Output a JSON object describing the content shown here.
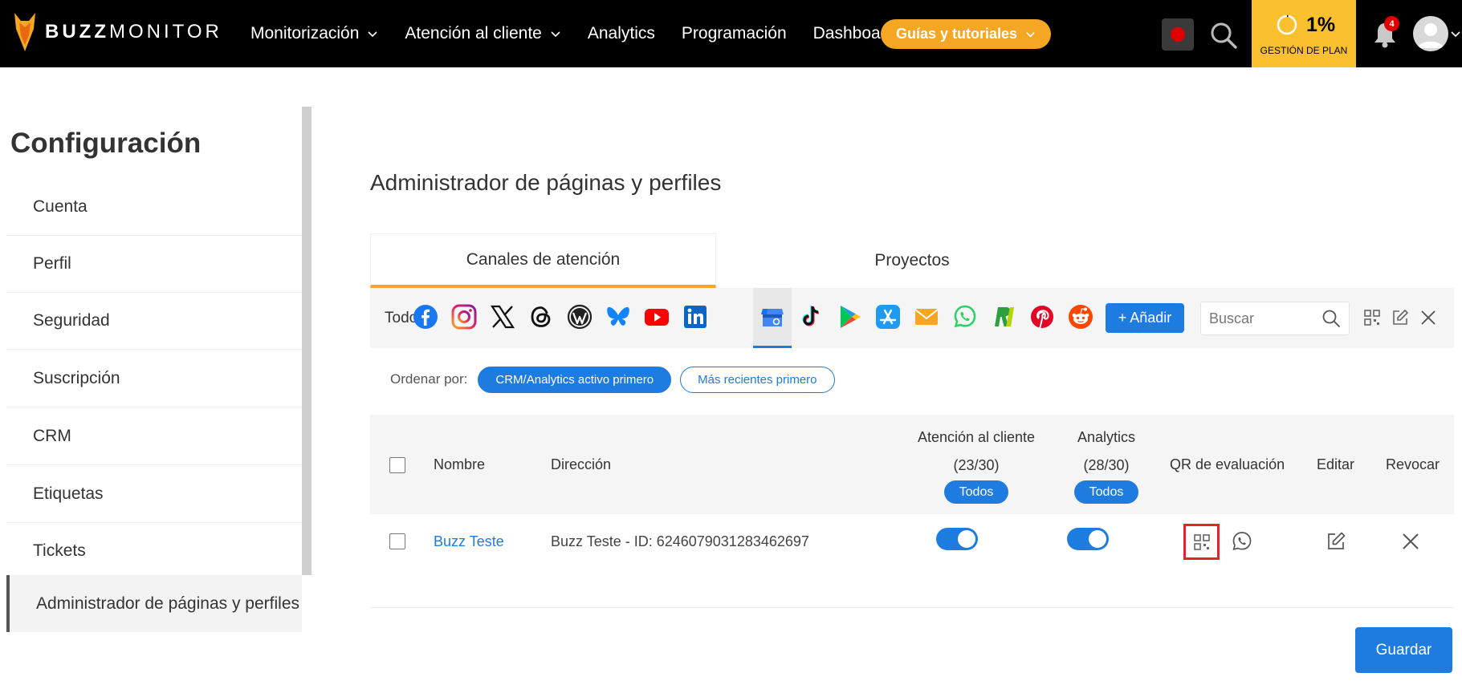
{
  "app": {
    "logo_bold": "BUZZ",
    "logo_light": "MONITOR"
  },
  "nav": {
    "items": [
      {
        "label": "Monitorización",
        "dropdown": true
      },
      {
        "label": "Atención al cliente",
        "dropdown": true
      },
      {
        "label": "Analytics",
        "dropdown": false
      },
      {
        "label": "Programación",
        "dropdown": false
      },
      {
        "label": "Dashboards",
        "dropdown": false
      }
    ],
    "guides_label": "Guías y tutoriales",
    "plan_percent": "1%",
    "plan_label": "GESTIÓN DE PLAN",
    "notifications_count": "4"
  },
  "sidebar": {
    "title": "Configuración",
    "items": [
      {
        "label": "Cuenta"
      },
      {
        "label": "Perfil"
      },
      {
        "label": "Seguridad"
      },
      {
        "label": "Suscripción"
      },
      {
        "label": "CRM"
      },
      {
        "label": "Etiquetas"
      },
      {
        "label": "Tickets"
      },
      {
        "label": "Administrador de páginas y perfiles",
        "active": true
      }
    ]
  },
  "main": {
    "title": "Administrador de páginas y perfiles",
    "tabs": [
      {
        "label": "Canales de atención",
        "active": true
      },
      {
        "label": "Proyectos",
        "active": false
      }
    ],
    "channels": {
      "all_label": "Todos",
      "icons": [
        "facebook-icon",
        "instagram-icon",
        "x-icon",
        "threads-icon",
        "wordpress-icon",
        "bluesky-icon",
        "youtube-icon",
        "linkedin-icon",
        "google-business-icon",
        "tiktok-icon",
        "google-play-icon",
        "app-store-icon",
        "email-icon",
        "whatsapp-icon",
        "reclame-aqui-icon",
        "pinterest-icon",
        "reddit-icon"
      ],
      "active_icon": "google-business-icon",
      "add_label": "+ Añadir",
      "search_placeholder": "Buscar"
    },
    "sort": {
      "label": "Ordenar por:",
      "options": [
        {
          "label": "CRM/Analytics activo primero",
          "selected": true
        },
        {
          "label": "Más recientes primero",
          "selected": false
        }
      ]
    },
    "table": {
      "headers": {
        "name": "Nombre",
        "address": "Dirección",
        "customer_service": "Atención al cliente",
        "customer_service_count": "(23/30)",
        "analytics": "Analytics",
        "analytics_count": "(28/30)",
        "todos": "Todos",
        "qr": "QR de evaluación",
        "edit": "Editar",
        "revoke": "Revocar"
      },
      "rows": [
        {
          "name": "Buzz Teste",
          "address": "Buzz Teste - ID: 6246079031283462697",
          "customer_service_on": true,
          "analytics_on": true
        }
      ]
    },
    "save_label": "Guardar"
  },
  "colors": {
    "accent": "#1e7be0",
    "orange": "#f5a623",
    "plan": "#fbc02d",
    "highlight": "#e0262b"
  }
}
